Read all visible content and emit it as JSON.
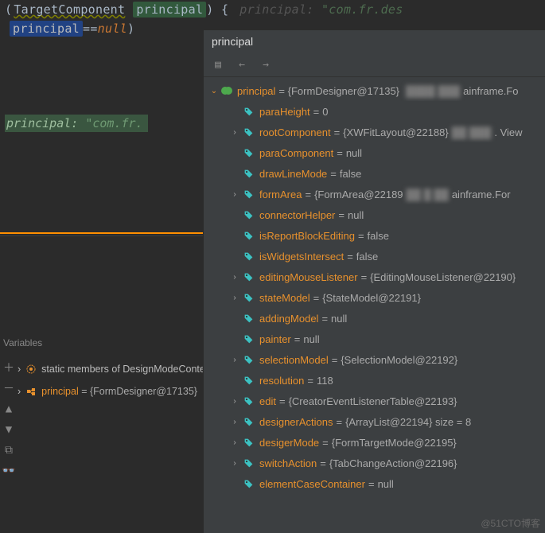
{
  "editor": {
    "line1": {
      "open_paren": "(",
      "type": "TargetComponent",
      "param": "principal",
      "close": ") {",
      "hint_label": "principal:",
      "hint_value": "\"com.fr.des"
    },
    "line2": {
      "var": "principal",
      "op": " == ",
      "rhs": "null",
      "close": ")"
    },
    "inline": {
      "label": "principal:",
      "value": "\"com.fr."
    }
  },
  "popup": {
    "title": "principal",
    "toolbar": {
      "history": "history-icon",
      "back": "back-icon",
      "forward": "forward-icon"
    },
    "root": {
      "name": "principal",
      "value_prefix": "= {FormDesigner@17135}",
      "value_blur": "████ ███",
      "value_suffix": "ainframe.Fo"
    },
    "children": [
      {
        "expandable": false,
        "name": "paraHeight",
        "value": "0"
      },
      {
        "expandable": true,
        "name": "rootComponent",
        "value": "{XWFitLayout@22188}",
        "blur": "██ ███",
        "suffix": ". View"
      },
      {
        "expandable": false,
        "name": "paraComponent",
        "value": "null"
      },
      {
        "expandable": false,
        "name": "drawLineMode",
        "value": "false"
      },
      {
        "expandable": true,
        "name": "formArea",
        "value": "{FormArea@22189",
        "blur": "██ █ ██",
        "suffix": "ainframe.For"
      },
      {
        "expandable": false,
        "name": "connectorHelper",
        "value": "null"
      },
      {
        "expandable": false,
        "name": "isReportBlockEditing",
        "value": "false"
      },
      {
        "expandable": false,
        "name": "isWidgetsIntersect",
        "value": "false"
      },
      {
        "expandable": true,
        "name": "editingMouseListener",
        "value": "{EditingMouseListener@22190}"
      },
      {
        "expandable": true,
        "name": "stateModel",
        "value": "{StateModel@22191}"
      },
      {
        "expandable": false,
        "name": "addingModel",
        "value": "null"
      },
      {
        "expandable": false,
        "name": "painter",
        "value": "null"
      },
      {
        "expandable": true,
        "name": "selectionModel",
        "value": "{SelectionModel@22192}"
      },
      {
        "expandable": false,
        "name": "resolution",
        "value": "118"
      },
      {
        "expandable": true,
        "name": "edit",
        "value": "{CreatorEventListenerTable@22193}"
      },
      {
        "expandable": true,
        "name": "designerActions",
        "value": "{ArrayList@22194}  size = 8"
      },
      {
        "expandable": true,
        "name": "desigerMode",
        "value": "{FormTargetMode@22195}"
      },
      {
        "expandable": true,
        "name": "switchAction",
        "value": "{TabChangeAction@22196}"
      },
      {
        "expandable": false,
        "name": "elementCaseContainer",
        "value": "null"
      }
    ]
  },
  "variables": {
    "title": "Variables",
    "rows": [
      {
        "label": "static members of DesignModeConte",
        "kind": "static"
      },
      {
        "label": "principal",
        "value": " = {FormDesigner@17135}",
        "kind": "obj"
      }
    ]
  },
  "watermark": "@51CTO博客"
}
